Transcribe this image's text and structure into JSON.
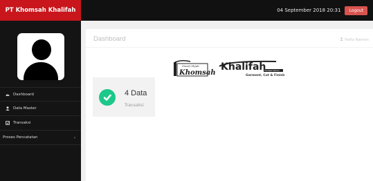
{
  "header": {
    "brand": "PT Khomsah Khalifah",
    "datetime": "04 September 2018 20:31",
    "logout_label": "Logout"
  },
  "sidebar": {
    "items": [
      {
        "label": "Dashboard",
        "icon": "dashboard-icon"
      },
      {
        "label": "Data Master",
        "icon": "user-icon"
      },
      {
        "label": "Transaksi",
        "icon": "transaction-icon"
      },
      {
        "label": "Proses Pencatatan",
        "icon": "chevron-left-icon"
      }
    ]
  },
  "main": {
    "page_title": "Dashboard",
    "user_name": "Hafiz Ramon",
    "logo": {
      "left_small": "Smart Hijab",
      "left_text": "Khomsah",
      "right_text": "Khalifah",
      "right_small": "The Best Fashion",
      "tagline": "Garment, Cut & Finish"
    },
    "info_box": {
      "count": "4 Data",
      "label": "Transaksi",
      "icon": "check-icon"
    }
  },
  "colors": {
    "brand_red": "#c8161c",
    "topbar": "#111111",
    "sidebar": "#141414",
    "success": "#1cc88a"
  }
}
